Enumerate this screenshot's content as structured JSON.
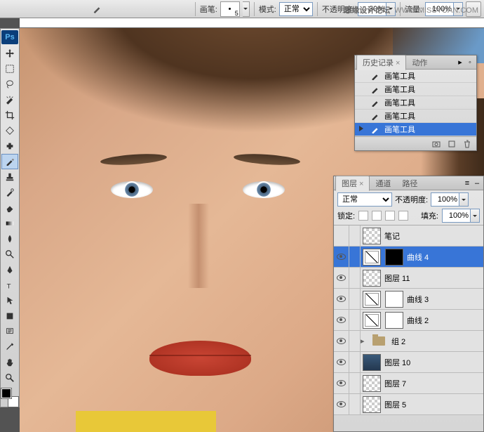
{
  "watermark": {
    "site": "思缘设计论坛",
    "url": "WWW.MISSYUAN.COM"
  },
  "options": {
    "brush_label": "画笔:",
    "brush_size": "5",
    "mode_label": "模式:",
    "mode_value": "正常",
    "opacity_label": "不透明度:",
    "opacity_value": "30%",
    "flow_label": "流量:",
    "flow_value": "100%"
  },
  "history": {
    "tab_history": "历史记录",
    "tab_actions": "动作",
    "item_label": "画笔工具",
    "rows": 5
  },
  "layers_panel": {
    "tab_layers": "图层",
    "tab_channels": "通道",
    "tab_paths": "路径",
    "blend_value": "正常",
    "opacity_label": "不透明度:",
    "opacity_value": "100%",
    "lock_label": "锁定:",
    "fill_label": "填充:",
    "fill_value": "100%"
  },
  "layers": [
    {
      "name": "笔记",
      "thumb": "checker",
      "vis": false
    },
    {
      "name": "曲线 4",
      "thumb": "curves",
      "mask": "mask",
      "vis": true,
      "sel": true
    },
    {
      "name": "图层 11",
      "thumb": "checker",
      "vis": true
    },
    {
      "name": "曲线 3",
      "thumb": "curves",
      "mask": "mask-white",
      "vis": true
    },
    {
      "name": "曲线 2",
      "thumb": "curves",
      "mask": "mask-white",
      "vis": true
    },
    {
      "name": "组 2",
      "thumb": "folder",
      "vis": true,
      "group": true
    },
    {
      "name": "图层 10",
      "thumb": "img",
      "vis": true
    },
    {
      "name": "图层 7",
      "thumb": "checker",
      "vis": true
    },
    {
      "name": "图层 5",
      "thumb": "checker",
      "vis": true
    }
  ]
}
